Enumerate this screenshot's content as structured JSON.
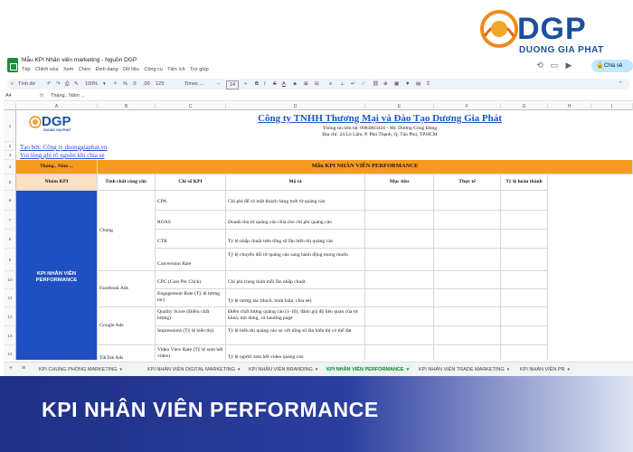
{
  "brand": {
    "name": "DGP",
    "tagline": "DUONG GIA PHAT",
    "colors": {
      "blue": "#1c4f9c",
      "orange": "#f08a1c"
    }
  },
  "window": {
    "doc_title": "Mẫu KPI Nhân viên marketing - Nguồn DGP",
    "menus": [
      "Tệp",
      "Chỉnh sửa",
      "Xem",
      "Chèn",
      "Định dạng",
      "Dữ liệu",
      "Công cụ",
      "Tiện ích",
      "Trợ giúp"
    ],
    "share_label": "Chia sẻ",
    "toolbar": {
      "search": "Tính đơ",
      "zoom": "100%",
      "font": "Times ...",
      "font_size": "14"
    },
    "formula_bar": {
      "cell_ref": "A4",
      "fx": "fx",
      "content": "Tháng.. Năm ..."
    }
  },
  "grid": {
    "columns": [
      "A",
      "B",
      "C",
      "D",
      "E",
      "F",
      "G",
      "H",
      "I"
    ],
    "rows": [
      "1",
      "2",
      "3",
      "4",
      "5",
      "6",
      "7",
      "8",
      "9",
      "10",
      "11",
      "12",
      "13",
      "14",
      "15"
    ]
  },
  "sheet": {
    "logo_text": "DGP",
    "logo_tag": "DUONG GIA PHAT",
    "company": "Công ty TNHH Thương Mại và Đào Tạo Dương Gia Phát",
    "phone": "Thông tin liên hệ: 0983883456 - Mr. Dương Công Đông",
    "address": "Địa chỉ: 24 Lò Lăm, P. Phú Thạnh, Q. Tân Phú, TP.HCM",
    "created_by": "Tạo bởi: Công ty duonggiaphat.vn",
    "source_note": "Vui lòng ghi rõ nguồn khi chia sẻ",
    "month_year": "Tháng.. Năm ...",
    "table_title": "Mẫu KPI NHÂN VIÊN PERFORMANCE",
    "headers": {
      "group": "Nhóm KPI",
      "channel": "Tính chất công việc",
      "metric": "Chỉ số KPI",
      "desc": "Mô tả",
      "target": "Mục tiêu",
      "actual": "Thực tế",
      "rate": "Tỷ lệ hoàn thành"
    },
    "kpi_group": "KPI NHÂN VIÊN PERFORMANCE",
    "channels": {
      "general": "Chung",
      "facebook": "Facebook Ads",
      "google": "Google Ads",
      "tiktok": "TikTok Ads"
    },
    "rows": [
      {
        "metric": "CPA",
        "desc": "Chi phí để có một khách hàng mới từ quảng cáo"
      },
      {
        "metric": "ROAS",
        "desc": "Doanh thu từ quảng cáo chia cho chi phí quảng cáo"
      },
      {
        "metric": "CTR",
        "desc": "Tỷ lệ nhấp chuột trên tổng số lần hiển thị quảng cáo"
      },
      {
        "metric": "Conversion Rate",
        "desc": "Tỷ lệ chuyển đổi từ quảng cáo sang hành động mong muốn"
      },
      {
        "metric": "CPC (Cost Per Click)",
        "desc": "Chi phí trung bình mỗi lần nhấp chuột"
      },
      {
        "metric": "Engagement Rate (Tỷ lệ tương tác)",
        "desc": "Tỷ lệ tương tác (thích, bình luận, chia sẻ)"
      },
      {
        "metric": "Quality Score (Điểm chất lượng)",
        "desc": "Điểm chất lượng quảng cáo (1-10), đánh giá độ liên quan của từ khóa, nội dung, và landing page"
      },
      {
        "metric": "Impressions (Tỷ lệ hiển thị)",
        "desc": "Tỷ lệ hiển thị quảng cáo so với tổng số lần hiển thị có thể đạt"
      },
      {
        "metric": "Video View Rate (Tỷ lệ xem hết video)",
        "desc": "Tỷ lệ người xem hết video quảng cáo"
      }
    ]
  },
  "tabs": [
    {
      "label": "KPI CHUNG PHÒNG MARKETING",
      "active": false
    },
    {
      "label": "KPI NHÂN VIÊN DIGITAL MARKETING",
      "active": false
    },
    {
      "label": "KPI NHÂN VIÊN BRANDING",
      "active": false
    },
    {
      "label": "KPI NHÂN VIÊN PERFORMANCE",
      "active": true
    },
    {
      "label": "KPI NHÂN VIÊN TRADE MARKETING",
      "active": false
    },
    {
      "label": "KPI NHÂN VIÊN PR",
      "active": false
    }
  ],
  "banner": {
    "title": "KPI NHÂN VIÊN PERFORMANCE"
  },
  "colors": {
    "header_orange": "#f79a1e",
    "header_peach": "#fbe0c2",
    "kpi_blue": "#1f4fc0",
    "banner_dark": "#1f2f86",
    "link_blue": "#1a56c4",
    "active_tab": "#188038"
  }
}
